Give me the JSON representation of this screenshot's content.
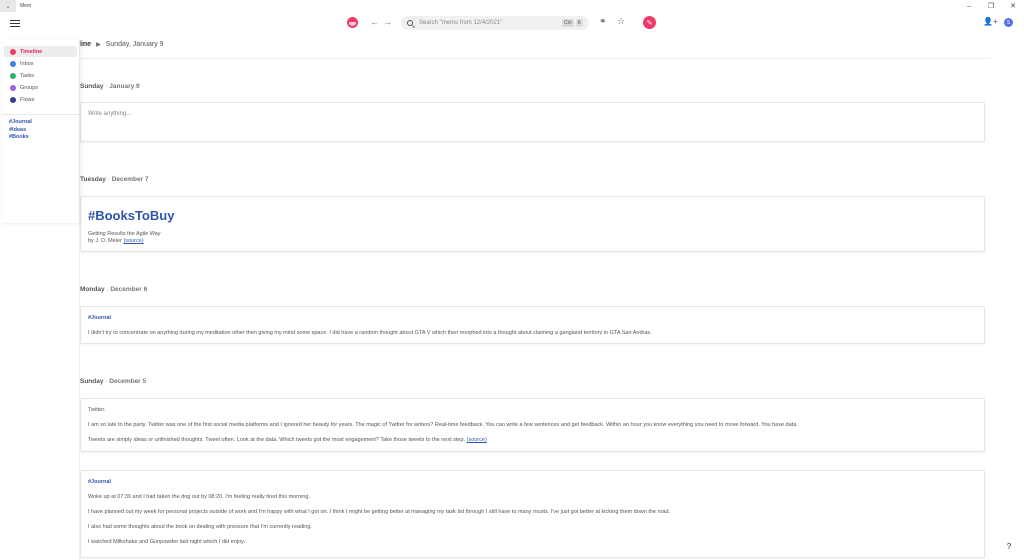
{
  "window": {
    "title": "Mem",
    "menu_icon": "chevron-down-icon",
    "minimize": "–",
    "maximize": "❐",
    "close": "✕"
  },
  "toolbar": {
    "back": "←",
    "forward": "→",
    "search_placeholder": "Search \"mems from 12/4/2021\"",
    "shortcut_ctrl": "Ctrl",
    "shortcut_key": "K",
    "link_icon": "⚭",
    "star_icon": "☆",
    "compose_icon": "✎",
    "adduser_icon": "👤+",
    "avatar_letter": "S",
    "accent": "#ef3a6a"
  },
  "sidebar": {
    "items": [
      {
        "label": "Timeline",
        "color": "#ef3a6a"
      },
      {
        "label": "Inbox",
        "color": "#4c7be8"
      },
      {
        "label": "Tasks",
        "color": "#2ab36b"
      },
      {
        "label": "Groups",
        "color": "#9a5fd8"
      },
      {
        "label": "Flows",
        "color": "#3a3a8c"
      }
    ],
    "tags": [
      "#Journal",
      "#Ideas",
      "#Books"
    ]
  },
  "breadcrumb": {
    "first": "line",
    "second": "Sunday, January 9"
  },
  "days": [
    {
      "day": "Sunday",
      "date": "January 9"
    },
    {
      "day": "Tuesday",
      "date": "December 7"
    },
    {
      "day": "Monday",
      "date": "December 6"
    },
    {
      "day": "Sunday",
      "date": "December 5"
    }
  ],
  "separator": "·",
  "editor": {
    "placeholder": "Write anything..."
  },
  "books_card": {
    "tag": "#BooksToBuy",
    "title": "Getting Results the Agile Way",
    "author_prefix": "by J. D. Meier",
    "source": "(source)"
  },
  "journal_card_1": {
    "tag": "#Journal",
    "text": "I didn't try to concentrate on anything during my meditation other then giving my mind some space. I did have a random thought about GTA V which then morphed into a thought about claiming a gangland territory in GTA San Andras."
  },
  "twitter_card": {
    "line1": "Twitter.",
    "line2": "I am so late to the party. Twitter was one of the first social media platforms and I ignored her beauty for years. The magic of Twitter for writers? Real-time feedback. You can write a few sentences and get feedback. Within an hour you know everything you need to move forward. You have data.",
    "line3": "Tweets are simply ideas or unfinished thoughts. Tweet often. Look at the data. Which tweets got the most engagement? Take those tweets to the next step.",
    "source": "(source)"
  },
  "journal_card_2": {
    "tag": "#Journal",
    "p1": "Woke up at 07:30 and I had taken the dog out by 08:20.  I'm feeling really tired this morning.",
    "p2": "I have planned out my week for personal projects outside of work and I'm happy with what I got on.  I think I might be getting better at managing my task list through I still have to many musts.  I've just got better at kicking them down the road.",
    "p3": "I also had some thoughts about the book on dealing with pressure that I'm currently reading.",
    "p4": "I watched Milkshake and Gunpowder last night which I did enjoy."
  },
  "help": "?"
}
